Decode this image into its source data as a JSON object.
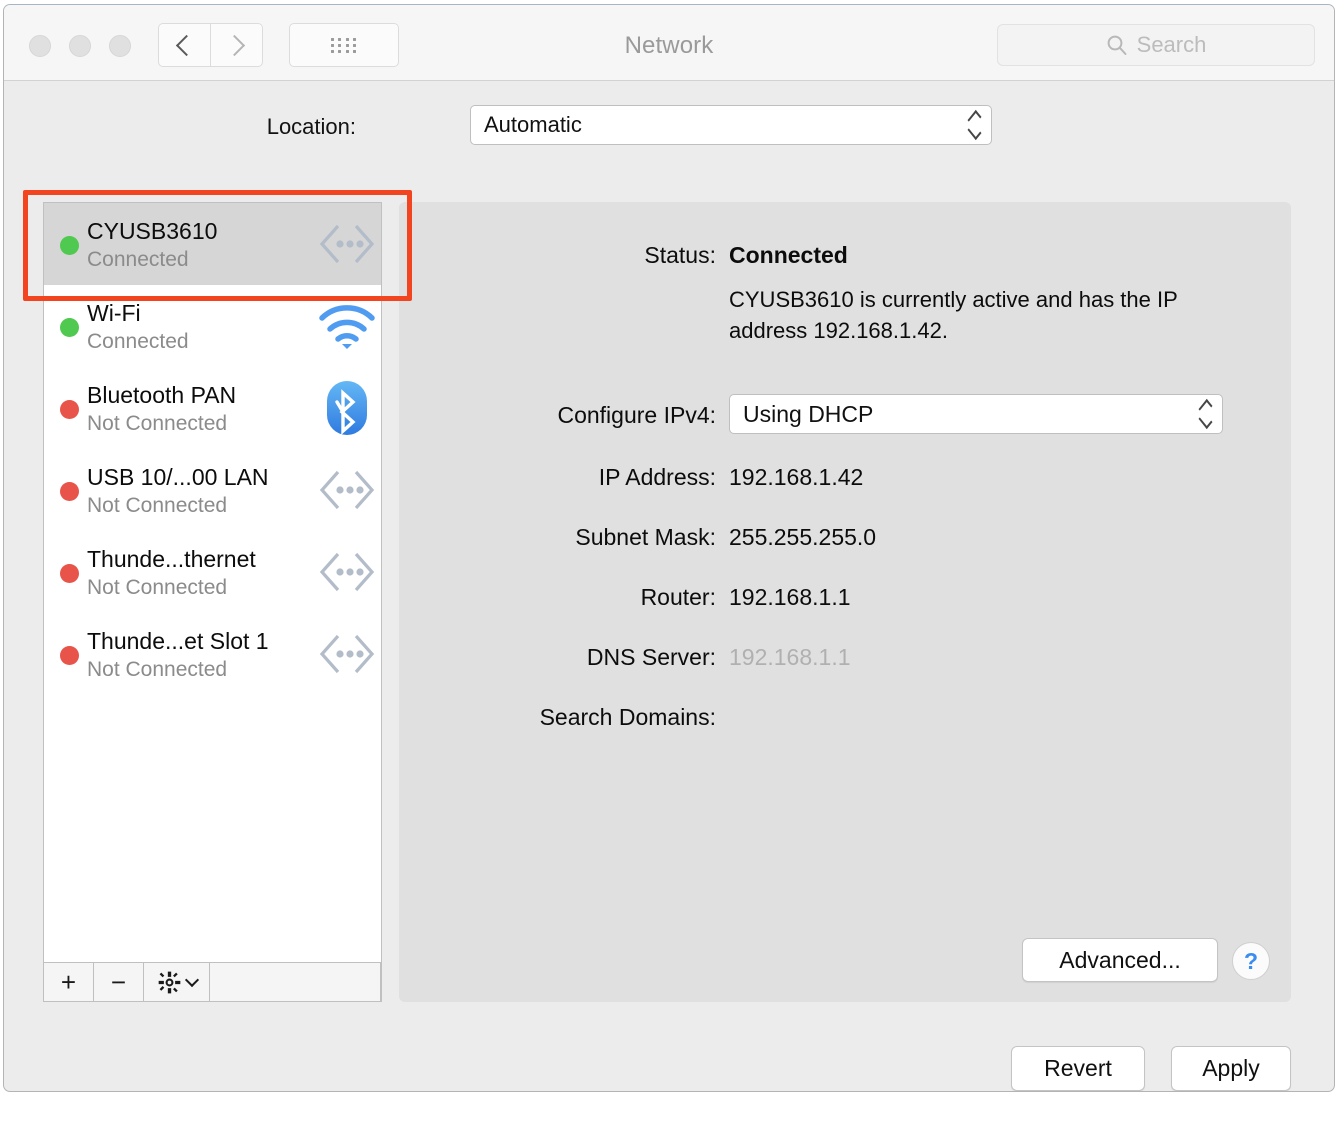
{
  "window": {
    "title": "Network",
    "traffic_lights": [
      "close",
      "minimize",
      "maximize"
    ]
  },
  "toolbar": {
    "back_icon": "chevron-left-icon",
    "forward_icon": "chevron-right-icon",
    "grid_icon": "show-all-grid-icon",
    "search": {
      "icon": "search-icon",
      "placeholder": "Search",
      "value": ""
    }
  },
  "location": {
    "label": "Location:",
    "value": "Automatic",
    "options": [
      "Automatic"
    ]
  },
  "sidebar": {
    "services": [
      {
        "name": "CYUSB3610",
        "status": "Connected",
        "state": "connected",
        "icon": "ethernet-icon",
        "selected": true
      },
      {
        "name": "Wi-Fi",
        "status": "Connected",
        "state": "connected",
        "icon": "wifi-icon",
        "selected": false
      },
      {
        "name": "Bluetooth PAN",
        "status": "Not Connected",
        "state": "disconnected",
        "icon": "bluetooth-icon",
        "selected": false
      },
      {
        "name": "USB 10/...00 LAN",
        "status": "Not Connected",
        "state": "disconnected",
        "icon": "ethernet-icon",
        "selected": false
      },
      {
        "name": "Thunde...thernet",
        "status": "Not Connected",
        "state": "disconnected",
        "icon": "ethernet-icon",
        "selected": false
      },
      {
        "name": "Thunde...et Slot 1",
        "status": "Not Connected",
        "state": "disconnected",
        "icon": "ethernet-icon",
        "selected": false
      }
    ],
    "toolbar": {
      "add_label": "+",
      "remove_label": "−",
      "gear_icon": "gear-icon"
    }
  },
  "detail": {
    "status_label": "Status:",
    "status_value": "Connected",
    "status_description": "CYUSB3610 is currently active and has the IP address 192.168.1.42.",
    "configure_ipv4_label": "Configure IPv4:",
    "configure_ipv4_value": "Using DHCP",
    "ip_address_label": "IP Address:",
    "ip_address_value": "192.168.1.42",
    "subnet_mask_label": "Subnet Mask:",
    "subnet_mask_value": "255.255.255.0",
    "router_label": "Router:",
    "router_value": "192.168.1.1",
    "dns_server_label": "DNS Server:",
    "dns_server_value": "192.168.1.1",
    "search_domains_label": "Search Domains:",
    "search_domains_value": "",
    "advanced_label": "Advanced...",
    "help_label": "?"
  },
  "footer": {
    "revert_label": "Revert",
    "apply_label": "Apply"
  },
  "annotation": {
    "color": "#f2451f",
    "target": "CYUSB3610"
  },
  "colors": {
    "connected_dot": "#4fc94f",
    "disconnected_dot": "#e8534a",
    "accent_blue": "#3a8cf0",
    "annotation_red": "#f2451f"
  }
}
